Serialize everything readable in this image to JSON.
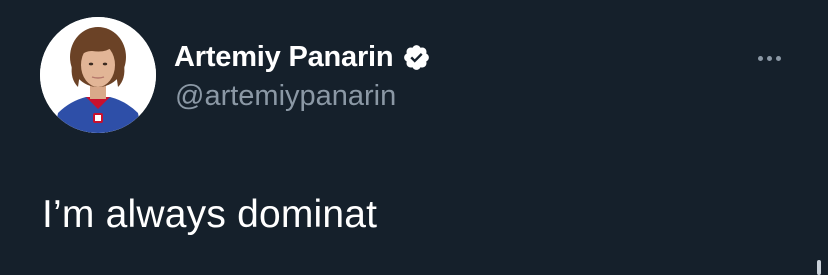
{
  "tweet": {
    "author": {
      "display_name": "Artemiy Panarin",
      "handle": "@artemiypanarin",
      "verified": true,
      "avatar_icon": "profile-photo"
    },
    "text": "I’m always dominat",
    "more_icon": "ellipsis-icon"
  },
  "colors": {
    "background": "#15202b",
    "name_text": "#ffffff",
    "secondary_text": "#8b98a5",
    "verified_badge": "#ffffff"
  }
}
